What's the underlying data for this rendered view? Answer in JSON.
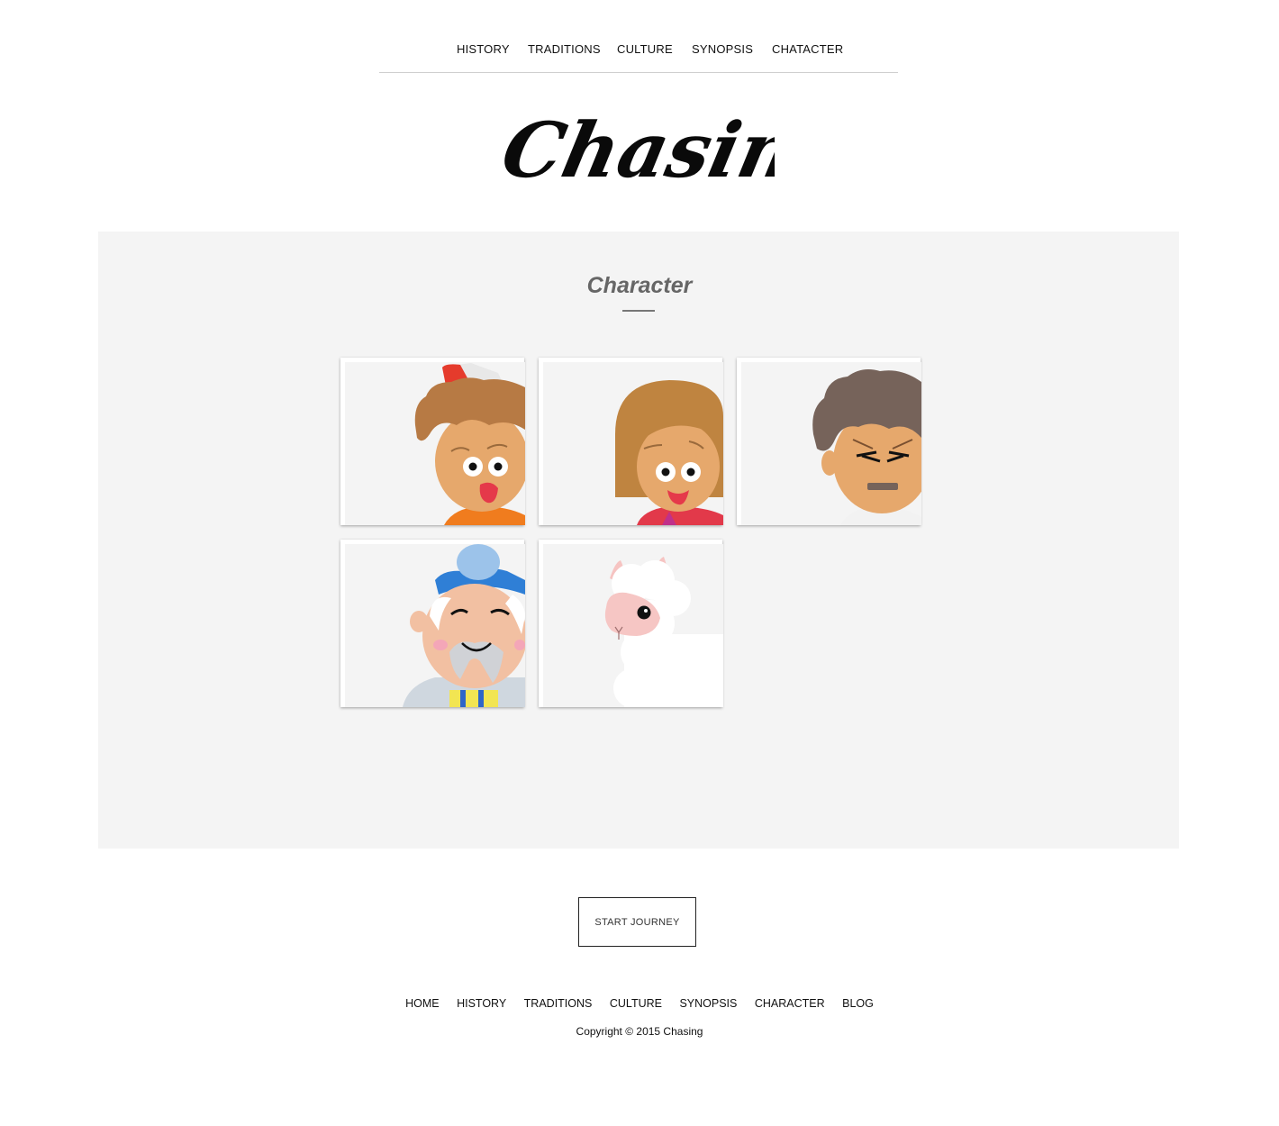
{
  "top_nav": [
    "HISTORY",
    "TRADITIONS",
    "CULTURE",
    "SYNOPSIS",
    "CHATACTER"
  ],
  "logo_text": "Chasing",
  "section": {
    "title": "Character"
  },
  "characters": [
    {
      "name": "boy-character"
    },
    {
      "name": "girl-character"
    },
    {
      "name": "father-character"
    },
    {
      "name": "grandfather-character"
    },
    {
      "name": "alpaca-character"
    }
  ],
  "cta": {
    "label": "START JOURNEY"
  },
  "footer_nav": [
    "HOME",
    "HISTORY",
    "TRADITIONS",
    "CULTURE",
    "SYNOPSIS",
    "CHARACTER",
    "BLOG"
  ],
  "copyright": "Copyright © 2015 Chasing"
}
